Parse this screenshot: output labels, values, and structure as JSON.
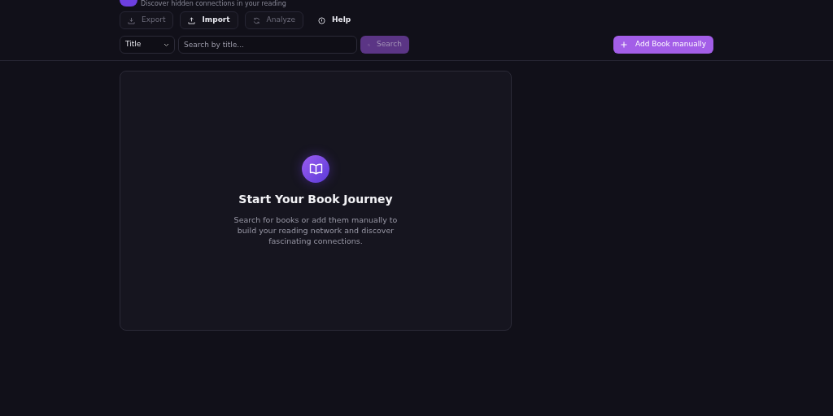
{
  "header": {
    "subtitle": "Discover hidden connections in your reading"
  },
  "toolbar": [
    {
      "kind": "export",
      "label": "Export",
      "disabled": true,
      "outlined": true
    },
    {
      "kind": "import",
      "label": "Import",
      "disabled": false,
      "outlined": true
    },
    {
      "kind": "analyze",
      "label": "Analyze",
      "disabled": true,
      "outlined": true
    },
    {
      "kind": "help",
      "label": "Help",
      "disabled": false,
      "outlined": false
    }
  ],
  "search": {
    "field_select": "Title",
    "placeholder": "Search by title...",
    "button": {
      "label": "Search",
      "disabled": true
    }
  },
  "add_button": {
    "label": "Add Book manually"
  },
  "empty_state": {
    "title": "Start Your Book Journey",
    "text": "Search for books or add them manually to build your reading network and discover fascinating connections."
  }
}
